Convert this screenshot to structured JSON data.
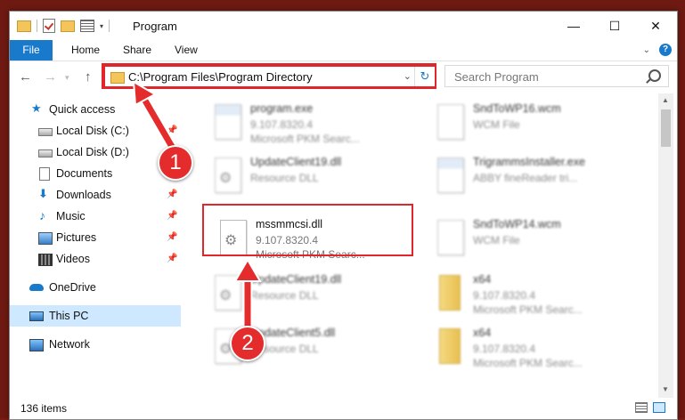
{
  "window": {
    "title": "Program",
    "controls": {
      "minimize": "—",
      "maximize": "☐",
      "close": "✕"
    }
  },
  "ribbon": {
    "tabs": [
      "File",
      "Home",
      "Share",
      "View"
    ],
    "help": "?"
  },
  "navigation": {
    "address": "C:\\Program Files\\Program Directory",
    "search_placeholder": "Search Program"
  },
  "sidebar": {
    "items": [
      {
        "label": "Quick access",
        "icon": "star-icon",
        "pinned": false
      },
      {
        "label": "Local Disk (C:)",
        "icon": "drive-icon",
        "pinned": true
      },
      {
        "label": "Local Disk (D:)",
        "icon": "drive-icon",
        "pinned": false
      },
      {
        "label": "Documents",
        "icon": "documents-icon",
        "pinned": true
      },
      {
        "label": "Downloads",
        "icon": "download-icon",
        "pinned": true
      },
      {
        "label": "Music",
        "icon": "music-icon",
        "pinned": true
      },
      {
        "label": "Pictures",
        "icon": "pictures-icon",
        "pinned": true
      },
      {
        "label": "Videos",
        "icon": "videos-icon",
        "pinned": true
      },
      {
        "label": "OneDrive",
        "icon": "onedrive-icon",
        "pinned": false
      },
      {
        "label": "This PC",
        "icon": "computer-icon",
        "pinned": false,
        "selected": true
      },
      {
        "label": "Network",
        "icon": "network-icon",
        "pinned": false
      }
    ]
  },
  "files": [
    {
      "name": "program.exe",
      "line1": "9.107.8320.4",
      "line2": "Microsoft PKM Searc...",
      "icon": "exe-icon"
    },
    {
      "name": "SndToWP16.wcm",
      "line1": "WCM File",
      "line2": "",
      "icon": "file-icon"
    },
    {
      "name": "UpdateClient19.dll",
      "line1": "Resource DLL",
      "line2": "",
      "icon": "dll-icon"
    },
    {
      "name": "TrigrammsInstaller.exe",
      "line1": "ABBY fineReader tri...",
      "line2": "",
      "icon": "exe-icon"
    },
    {
      "name": "mssmmcsi.dll",
      "line1": "9.107.8320.4",
      "line2": "Microsoft PKM Searc...",
      "icon": "dll-icon",
      "highlighted": true
    },
    {
      "name": "SndToWP14.wcm",
      "line1": "WCM File",
      "line2": "",
      "icon": "file-icon"
    },
    {
      "name": "UpdateClient19.dll",
      "line1": "Resource DLL",
      "line2": "",
      "icon": "dll-icon"
    },
    {
      "name": "x64",
      "line1": "9.107.8320.4",
      "line2": "Microsoft PKM Searc...",
      "icon": "zip-icon"
    },
    {
      "name": "UpdateClient5.dll",
      "line1": "Resource DLL",
      "line2": "",
      "icon": "dll-icon"
    },
    {
      "name": "x64",
      "line1": "9.107.8320.4",
      "line2": "Microsoft PKM Searc...",
      "icon": "zip-icon"
    }
  ],
  "status": {
    "item_count": "136 items"
  },
  "annotations": {
    "step1": "1",
    "step2": "2",
    "highlight_color": "#e0262b",
    "callout_color": "#e32c2b"
  }
}
